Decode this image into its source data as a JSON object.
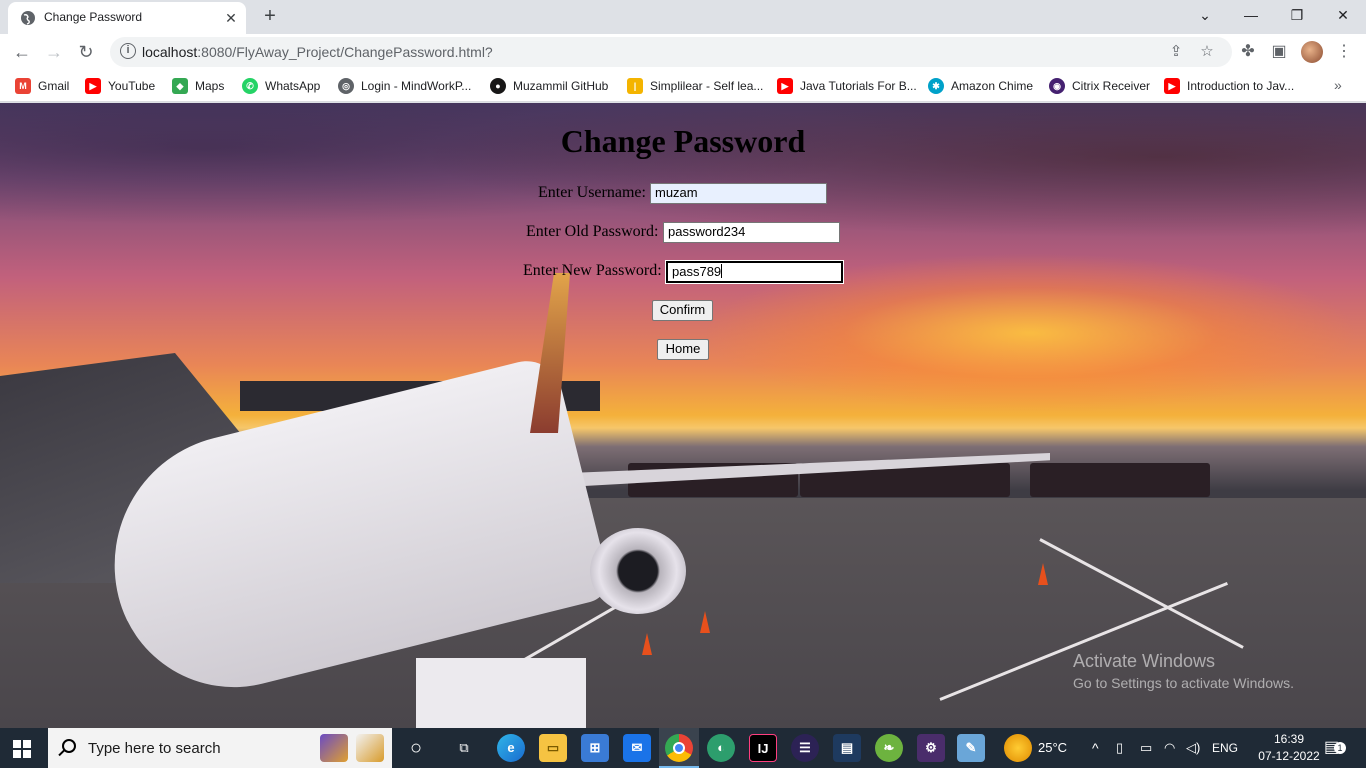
{
  "browser": {
    "tab_title": "Change Password",
    "url_host": "localhost",
    "url_path": ":8080/FlyAway_Project/ChangePassword.html?",
    "bookmarks": [
      {
        "label": "Gmail",
        "icon": "gmail-icon",
        "color": "#ea4335"
      },
      {
        "label": "YouTube",
        "icon": "youtube-icon",
        "color": "#ff0000"
      },
      {
        "label": "Maps",
        "icon": "maps-icon",
        "color": "#34a853"
      },
      {
        "label": "WhatsApp",
        "icon": "whatsapp-icon",
        "color": "#25d366"
      },
      {
        "label": "Login - MindWorkP...",
        "icon": "globe-icon",
        "color": "#5f6368"
      },
      {
        "label": "Muzammil GitHub",
        "icon": "github-icon",
        "color": "#181717"
      },
      {
        "label": "Simplilear - Self lea...",
        "icon": "simplilearn-icon",
        "color": "#f4b400"
      },
      {
        "label": "Java Tutorials For B...",
        "icon": "youtube-icon",
        "color": "#ff0000"
      },
      {
        "label": "Amazon Chime",
        "icon": "chime-icon",
        "color": "#00a1c9"
      },
      {
        "label": "Citrix Receiver",
        "icon": "citrix-icon",
        "color": "#452170"
      },
      {
        "label": "Introduction to Jav...",
        "icon": "youtube-icon",
        "color": "#ff0000"
      }
    ]
  },
  "form": {
    "title": "Change Password",
    "username_label": "Enter Username:",
    "username_value": "muzam",
    "old_password_label": "Enter Old Password:",
    "old_password_value": "password234",
    "new_password_label": "Enter New Password:",
    "new_password_value": "pass789",
    "confirm_label": "Confirm",
    "home_label": "Home"
  },
  "watermark": {
    "title": "Activate Windows",
    "subtitle": "Go to Settings to activate Windows."
  },
  "taskbar": {
    "search_placeholder": "Type here to search",
    "weather": "25°C",
    "language": "ENG",
    "time": "16:39",
    "date": "07-12-2022",
    "notification_count": "1"
  }
}
